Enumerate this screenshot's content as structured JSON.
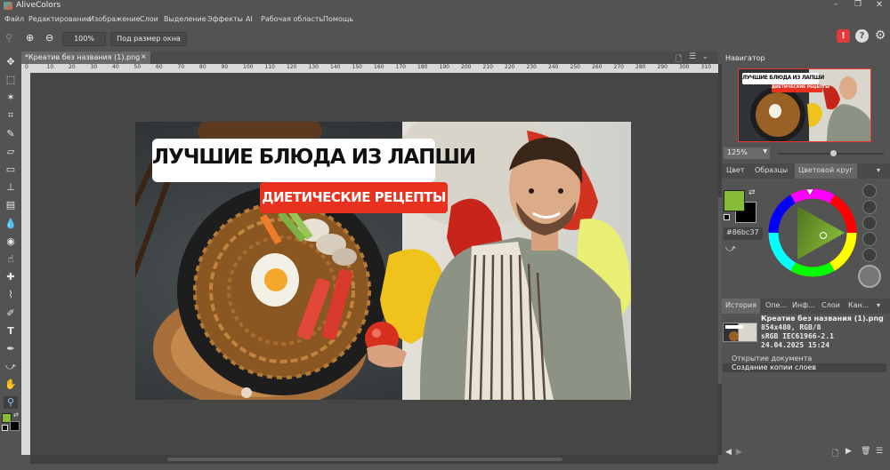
{
  "app": {
    "title": "AliveColors"
  },
  "menu": [
    "Файл",
    "Редактирование",
    "Изображение",
    "Слои",
    "Выделение",
    "Эффекты",
    "AI",
    "Рабочая область",
    "Помощь"
  ],
  "options": {
    "zoom_value": "100%",
    "fit_label": "Под размер окна"
  },
  "document": {
    "tab_label": "*Креатив без названия (1).png",
    "close": "×"
  },
  "ruler_ticks": [
    "0",
    "10",
    "20",
    "30",
    "40",
    "50",
    "60",
    "70",
    "80",
    "90",
    "100",
    "110",
    "120",
    "130",
    "140",
    "150",
    "160",
    "170",
    "180",
    "190",
    "200",
    "210",
    "220",
    "230",
    "240",
    "250",
    "260",
    "270",
    "280",
    "290",
    "300",
    "310"
  ],
  "image": {
    "headline": "ЛУЧШИЕ БЛЮДА ИЗ ЛАПШИ",
    "subline": "ДИЕТИЧЕСКИЕ РЕЦЕПТЫ"
  },
  "navigator": {
    "title": "Навигатор",
    "zoom": "125%",
    "thumb_headline": "ЛУЧШИЕ БЛЮДА ИЗ ЛАПШИ",
    "thumb_subline": "ДИЕТИЧЕСКИЕ РЕЦЕПТЫ"
  },
  "color_panel": {
    "tabs": [
      "Цвет",
      "Образцы",
      "Цветовой круг"
    ],
    "hex": "#86bc37",
    "fg": "#86bc37",
    "bg": "#000000"
  },
  "history": {
    "tabs": [
      "История",
      "Опе...",
      "Инф...",
      "Слои",
      "Кан..."
    ],
    "file_name": "Креатив без названия (1).png",
    "file_size": "854x480, RGB/8",
    "profile": "sRGB IEC61966-2.1",
    "date": "24.04.2025 15:24",
    "items": [
      "Открытие документа",
      "Создание копии слоев"
    ]
  },
  "colors": {
    "accent": "#86bc37",
    "alert": "#e03a3a",
    "red_banner": "#e8321f"
  }
}
